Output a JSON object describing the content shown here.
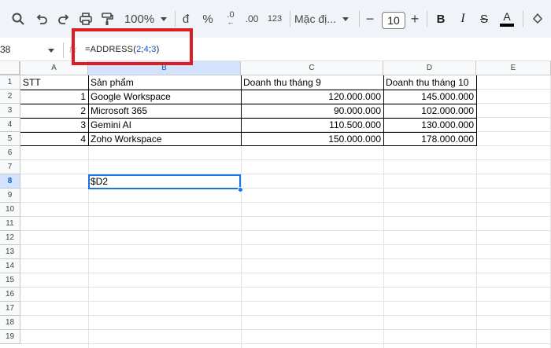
{
  "toolbar": {
    "zoom": "100%",
    "currency_symbol": "đ",
    "percent_symbol": "%",
    "decimal_label": ".0",
    "decimal_arrow": "←",
    "decimal_increase_label": ".00",
    "format_123": "123",
    "font_name": "Mặc đị...",
    "decrease_label": "−",
    "font_size": "10",
    "increase_label": "+",
    "bold_label": "B",
    "italic_label": "I",
    "strike_label": "S",
    "text_color_label": "A",
    "icons": [
      "search-icon",
      "undo-icon",
      "redo-icon",
      "print-icon",
      "paint-format-icon"
    ]
  },
  "formula_bar": {
    "name_box": "38",
    "fx_label": "fx",
    "formula_prefix": "=ADDRESS(",
    "arg1": "2",
    "sep1": ";",
    "arg2": "4",
    "sep2": ";",
    "arg3": "3",
    "formula_suffix": ")"
  },
  "columns": [
    "A",
    "B",
    "C",
    "D",
    "E"
  ],
  "rows": [
    "1",
    "2",
    "3",
    "4",
    "5",
    "6",
    "7",
    "8",
    "9",
    "10",
    "11",
    "12",
    "13",
    "14",
    "15",
    "16",
    "17",
    "18",
    "19"
  ],
  "selected": {
    "column": "B",
    "row": "8"
  },
  "table": {
    "headers": [
      "STT",
      "Sản phẩm",
      "Doanh thu tháng 9",
      "Doanh thu tháng 10"
    ],
    "rows": [
      [
        "1",
        "Google Workspace",
        "120.000.000",
        "145.000.000"
      ],
      [
        "2",
        "Microsoft 365",
        "90.000.000",
        "102.000.000"
      ],
      [
        "3",
        "Gemini AI",
        "110.500.000",
        "130.000.000"
      ],
      [
        "4",
        "Zoho Workspace",
        "150.000.000",
        "178.000.000"
      ]
    ]
  },
  "result_cell": "$D2",
  "colors": {
    "highlight": "#dc1e24",
    "selection": "#1a73e8",
    "toolbar_bg": "#f0f4f9"
  }
}
